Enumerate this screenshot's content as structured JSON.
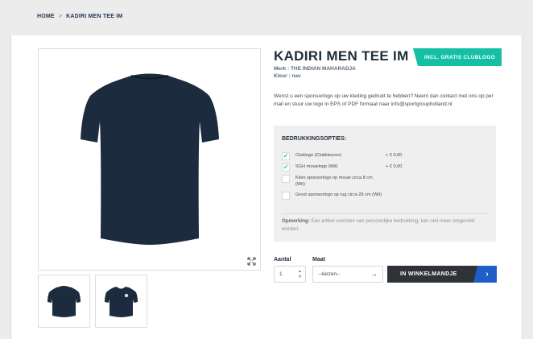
{
  "breadcrumb": {
    "home": "HOME",
    "separator": ">",
    "current": "KADIRI MEN TEE IM"
  },
  "product": {
    "title": "KADIRI MEN TEE IM",
    "badge": "INCL. GRATIS CLUBLOGO",
    "brand": "Merk : THE INDIAN MAHARADJA",
    "color": "Kleur : nav",
    "description": "Wenst u een sponsorlogo op uw kleding gedrukt te hebben? Neem dan contact met ons op per mail en stuur uw logo in EPS of PDF formaat naar info@sportgroupholland.nl",
    "shirt_color": "#1c2b3e"
  },
  "options": {
    "title": "BEDRUKKINGSOPTIES:",
    "items": [
      {
        "label": "Clublogo (Clubkleuren)",
        "price": "+ € 0,00",
        "checked": true
      },
      {
        "label": "SGH mouwlogo (Wit)",
        "price": "+ € 0,00",
        "checked": true
      },
      {
        "label": "Klein sponsorlogo op mouw circa 8 cm (Wit)",
        "price": "",
        "checked": false
      },
      {
        "label": "Groot sponsorlogo op rug circa 26 cm (Wit)",
        "price": "",
        "checked": false
      }
    ],
    "remark_label": "Opmerking:",
    "remark_text": " Een artikel voorzien van persoonlijke bedrukking, kan niet meer omgeruild worden."
  },
  "purchase": {
    "qty_label": "Aantal",
    "qty_value": "1",
    "size_label": "Maat",
    "size_value": "--kiezen--",
    "cart_label": "IN WINKELMANDJE"
  },
  "colors": {
    "accent_teal": "#15bfa6",
    "cart_blue": "#1e5fc7",
    "cart_dark": "#2f3236"
  }
}
